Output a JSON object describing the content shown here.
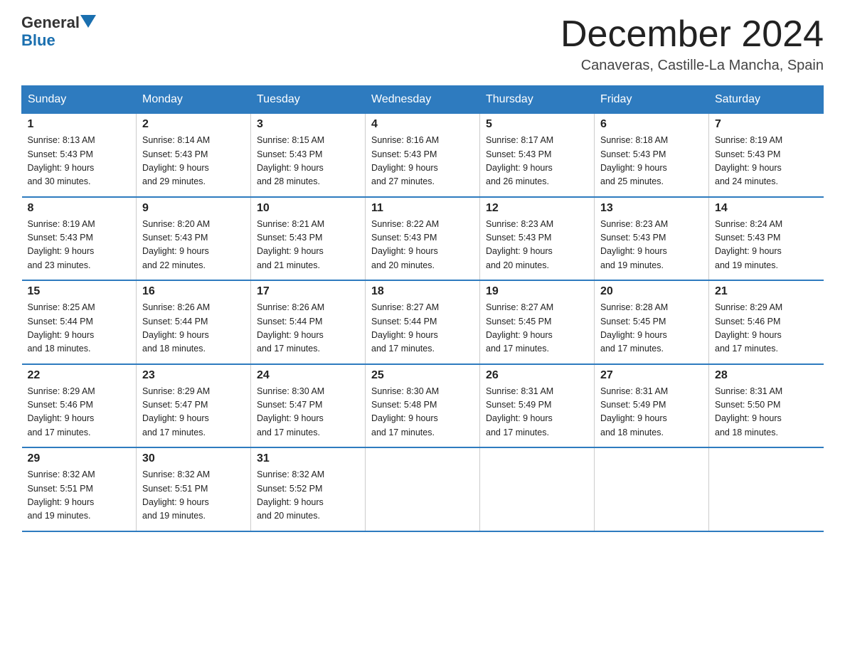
{
  "logo": {
    "general": "General",
    "blue": "Blue"
  },
  "header": {
    "month_year": "December 2024",
    "location": "Canaveras, Castille-La Mancha, Spain"
  },
  "days_of_week": [
    "Sunday",
    "Monday",
    "Tuesday",
    "Wednesday",
    "Thursday",
    "Friday",
    "Saturday"
  ],
  "weeks": [
    [
      {
        "day": "1",
        "sunrise": "8:13 AM",
        "sunset": "5:43 PM",
        "daylight": "9 hours and 30 minutes."
      },
      {
        "day": "2",
        "sunrise": "8:14 AM",
        "sunset": "5:43 PM",
        "daylight": "9 hours and 29 minutes."
      },
      {
        "day": "3",
        "sunrise": "8:15 AM",
        "sunset": "5:43 PM",
        "daylight": "9 hours and 28 minutes."
      },
      {
        "day": "4",
        "sunrise": "8:16 AM",
        "sunset": "5:43 PM",
        "daylight": "9 hours and 27 minutes."
      },
      {
        "day": "5",
        "sunrise": "8:17 AM",
        "sunset": "5:43 PM",
        "daylight": "9 hours and 26 minutes."
      },
      {
        "day": "6",
        "sunrise": "8:18 AM",
        "sunset": "5:43 PM",
        "daylight": "9 hours and 25 minutes."
      },
      {
        "day": "7",
        "sunrise": "8:19 AM",
        "sunset": "5:43 PM",
        "daylight": "9 hours and 24 minutes."
      }
    ],
    [
      {
        "day": "8",
        "sunrise": "8:19 AM",
        "sunset": "5:43 PM",
        "daylight": "9 hours and 23 minutes."
      },
      {
        "day": "9",
        "sunrise": "8:20 AM",
        "sunset": "5:43 PM",
        "daylight": "9 hours and 22 minutes."
      },
      {
        "day": "10",
        "sunrise": "8:21 AM",
        "sunset": "5:43 PM",
        "daylight": "9 hours and 21 minutes."
      },
      {
        "day": "11",
        "sunrise": "8:22 AM",
        "sunset": "5:43 PM",
        "daylight": "9 hours and 20 minutes."
      },
      {
        "day": "12",
        "sunrise": "8:23 AM",
        "sunset": "5:43 PM",
        "daylight": "9 hours and 20 minutes."
      },
      {
        "day": "13",
        "sunrise": "8:23 AM",
        "sunset": "5:43 PM",
        "daylight": "9 hours and 19 minutes."
      },
      {
        "day": "14",
        "sunrise": "8:24 AM",
        "sunset": "5:43 PM",
        "daylight": "9 hours and 19 minutes."
      }
    ],
    [
      {
        "day": "15",
        "sunrise": "8:25 AM",
        "sunset": "5:44 PM",
        "daylight": "9 hours and 18 minutes."
      },
      {
        "day": "16",
        "sunrise": "8:26 AM",
        "sunset": "5:44 PM",
        "daylight": "9 hours and 18 minutes."
      },
      {
        "day": "17",
        "sunrise": "8:26 AM",
        "sunset": "5:44 PM",
        "daylight": "9 hours and 17 minutes."
      },
      {
        "day": "18",
        "sunrise": "8:27 AM",
        "sunset": "5:44 PM",
        "daylight": "9 hours and 17 minutes."
      },
      {
        "day": "19",
        "sunrise": "8:27 AM",
        "sunset": "5:45 PM",
        "daylight": "9 hours and 17 minutes."
      },
      {
        "day": "20",
        "sunrise": "8:28 AM",
        "sunset": "5:45 PM",
        "daylight": "9 hours and 17 minutes."
      },
      {
        "day": "21",
        "sunrise": "8:29 AM",
        "sunset": "5:46 PM",
        "daylight": "9 hours and 17 minutes."
      }
    ],
    [
      {
        "day": "22",
        "sunrise": "8:29 AM",
        "sunset": "5:46 PM",
        "daylight": "9 hours and 17 minutes."
      },
      {
        "day": "23",
        "sunrise": "8:29 AM",
        "sunset": "5:47 PM",
        "daylight": "9 hours and 17 minutes."
      },
      {
        "day": "24",
        "sunrise": "8:30 AM",
        "sunset": "5:47 PM",
        "daylight": "9 hours and 17 minutes."
      },
      {
        "day": "25",
        "sunrise": "8:30 AM",
        "sunset": "5:48 PM",
        "daylight": "9 hours and 17 minutes."
      },
      {
        "day": "26",
        "sunrise": "8:31 AM",
        "sunset": "5:49 PM",
        "daylight": "9 hours and 17 minutes."
      },
      {
        "day": "27",
        "sunrise": "8:31 AM",
        "sunset": "5:49 PM",
        "daylight": "9 hours and 18 minutes."
      },
      {
        "day": "28",
        "sunrise": "8:31 AM",
        "sunset": "5:50 PM",
        "daylight": "9 hours and 18 minutes."
      }
    ],
    [
      {
        "day": "29",
        "sunrise": "8:32 AM",
        "sunset": "5:51 PM",
        "daylight": "9 hours and 19 minutes."
      },
      {
        "day": "30",
        "sunrise": "8:32 AM",
        "sunset": "5:51 PM",
        "daylight": "9 hours and 19 minutes."
      },
      {
        "day": "31",
        "sunrise": "8:32 AM",
        "sunset": "5:52 PM",
        "daylight": "9 hours and 20 minutes."
      },
      null,
      null,
      null,
      null
    ]
  ],
  "sunrise_label": "Sunrise:",
  "sunset_label": "Sunset:",
  "daylight_label": "Daylight:"
}
